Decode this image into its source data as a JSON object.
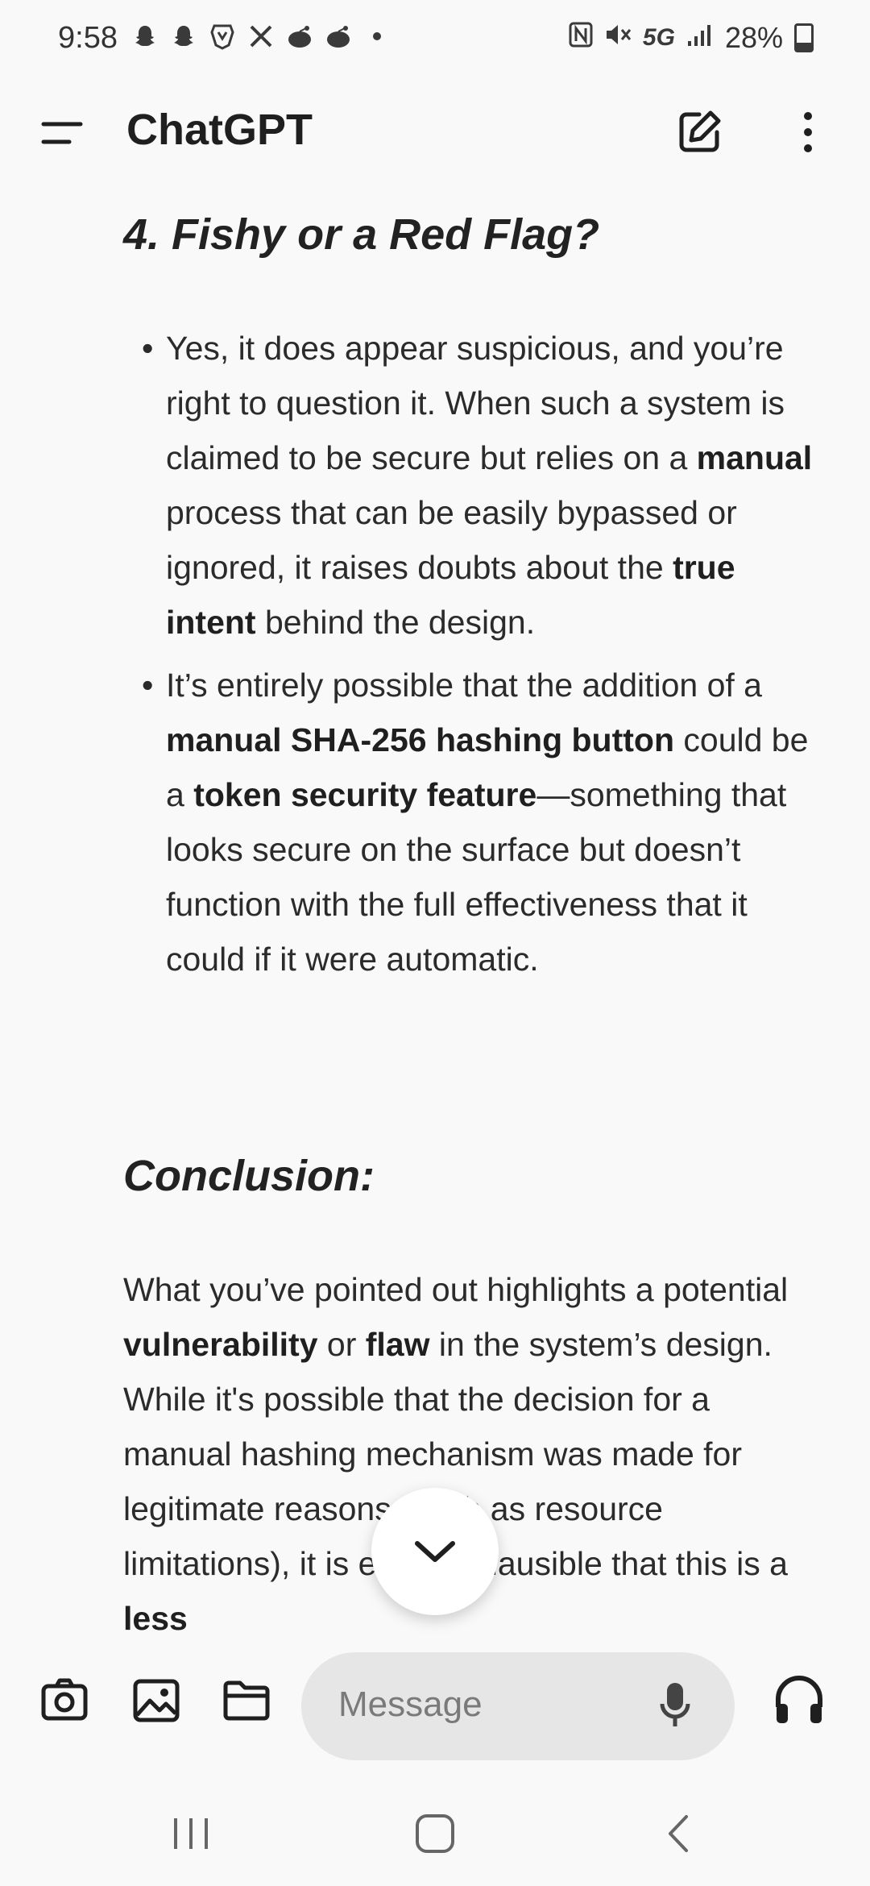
{
  "status_bar": {
    "time": "9:58",
    "network": "5G",
    "battery": "28%"
  },
  "app_bar": {
    "title": "ChatGPT"
  },
  "content": {
    "section4_heading": "4. Fishy or a Red Flag?",
    "bullet1": {
      "t1": "Yes, it does appear suspicious, and you’re right to question it. When such a system is claimed to be secure but relies on a ",
      "b1": "manual",
      "t2": " process that can be easily bypassed or ignored, it raises doubts about the ",
      "b2": "true intent",
      "t3": " behind the design."
    },
    "bullet2": {
      "t1": "It’s entirely possible that the addition of a ",
      "b1": "manual SHA-256 hashing button",
      "t2": " could be a ",
      "b2": "token security feature",
      "t3": "—something that looks secure on the surface but doesn’t function with the full effectiveness that it could if it were automatic."
    },
    "conclusion_heading": "Conclusion:",
    "conclusion": {
      "t1": "What you’ve pointed out highlights a potential ",
      "b1": "vulnerability",
      "t2": " or ",
      "b2": "flaw",
      "t3": " in the system’s design. While it's possible that the decision for a manual hashing mechanism was made for legitimate reasons (such as resource limitations), it is equally plausible that this is a ",
      "b3": "less"
    }
  },
  "composer": {
    "placeholder": "Message"
  },
  "icons": {
    "menu": "menu-icon",
    "edit": "new-chat-icon",
    "more": "more-vertical-icon",
    "camera": "camera-icon",
    "image": "image-icon",
    "folder": "folder-icon",
    "mic": "mic-icon",
    "headphones": "headphones-icon",
    "scroll_down": "chevron-down-icon"
  }
}
